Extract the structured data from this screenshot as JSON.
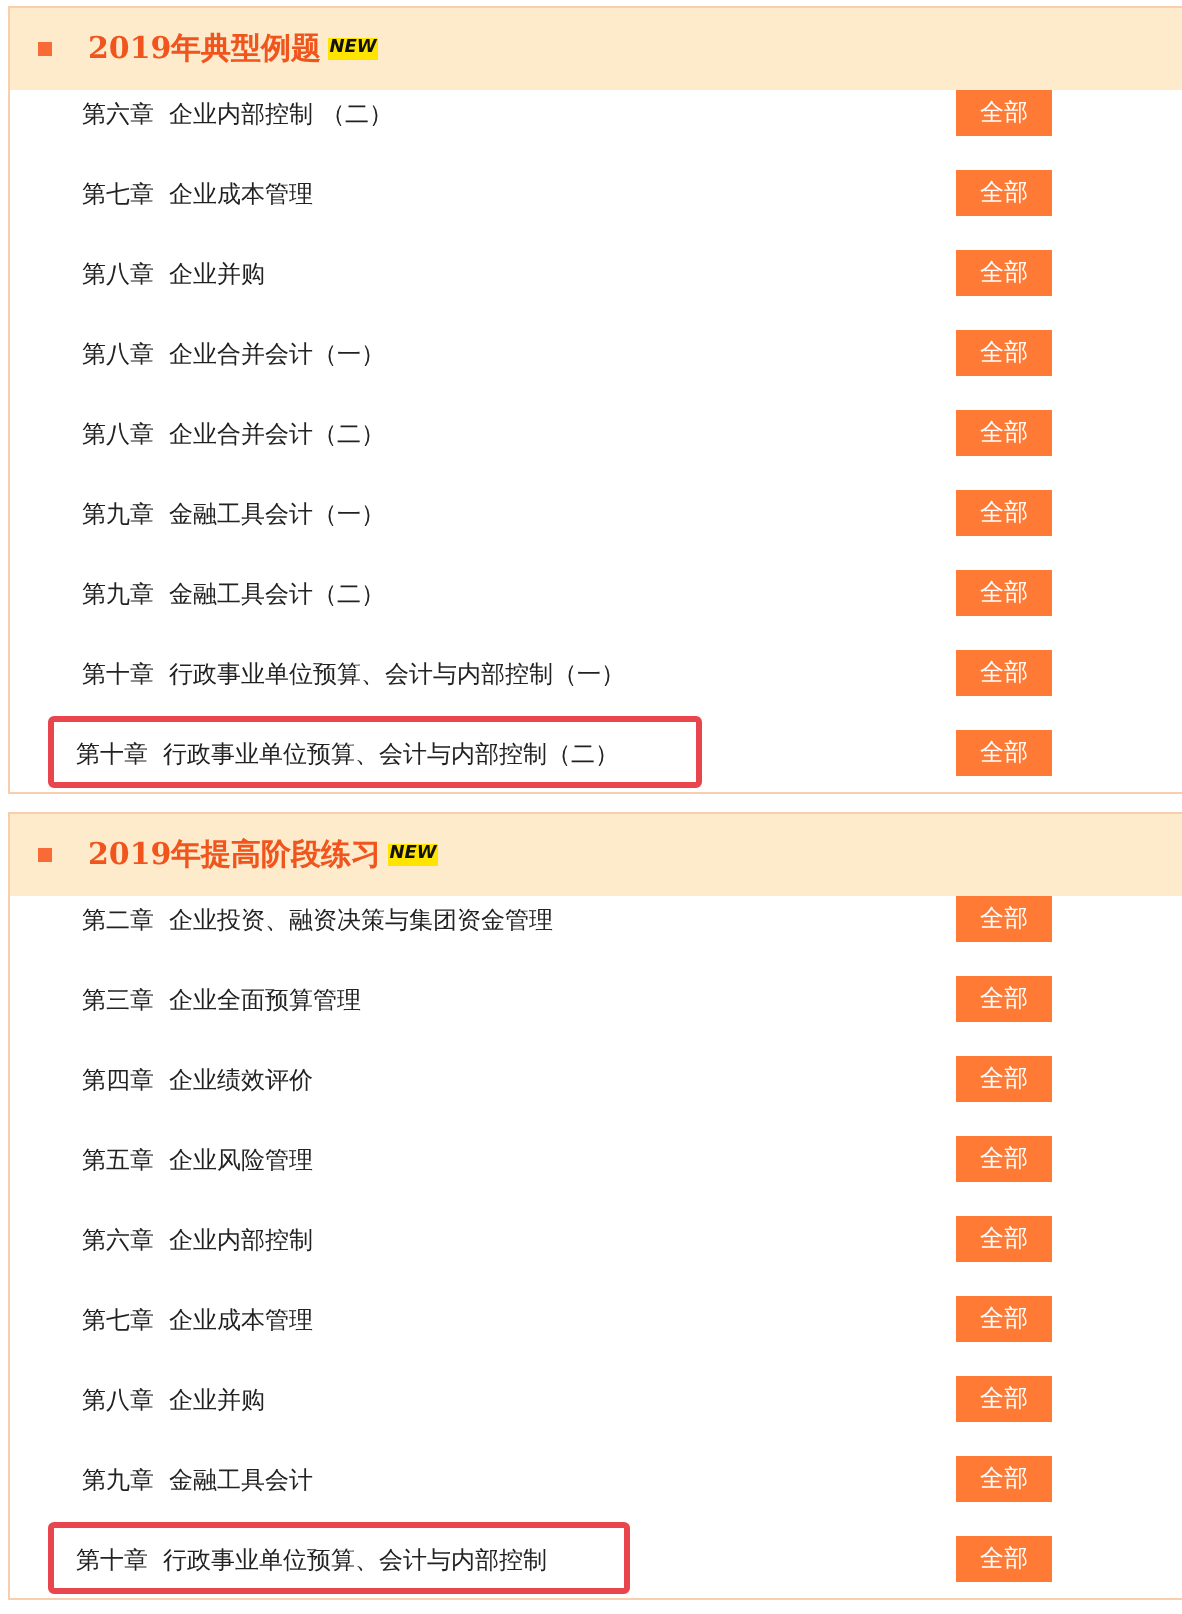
{
  "sections": [
    {
      "title": "2019年典型例题",
      "badge": "NEW",
      "rows": [
        {
          "chapter": "第六章  企业内部控制 （二）",
          "button": "全部",
          "highlighted": false
        },
        {
          "chapter": "第七章  企业成本管理",
          "button": "全部",
          "highlighted": false
        },
        {
          "chapter": "第八章  企业并购",
          "button": "全部",
          "highlighted": false
        },
        {
          "chapter": "第八章  企业合并会计（一）",
          "button": "全部",
          "highlighted": false
        },
        {
          "chapter": "第八章  企业合并会计（二）",
          "button": "全部",
          "highlighted": false
        },
        {
          "chapter": "第九章  金融工具会计（一）",
          "button": "全部",
          "highlighted": false
        },
        {
          "chapter": "第九章  金融工具会计（二）",
          "button": "全部",
          "highlighted": false
        },
        {
          "chapter": "第十章  行政事业单位预算、会计与内部控制（一）",
          "button": "全部",
          "highlighted": false
        },
        {
          "chapter": "第十章  行政事业单位预算、会计与内部控制（二）",
          "button": "全部",
          "highlighted": true
        }
      ]
    },
    {
      "title": "2019年提高阶段练习",
      "badge": "NEW",
      "rows": [
        {
          "chapter": "第二章  企业投资、融资决策与集团资金管理",
          "button": "全部",
          "highlighted": false
        },
        {
          "chapter": "第三章  企业全面预算管理",
          "button": "全部",
          "highlighted": false
        },
        {
          "chapter": "第四章  企业绩效评价",
          "button": "全部",
          "highlighted": false
        },
        {
          "chapter": "第五章  企业风险管理",
          "button": "全部",
          "highlighted": false
        },
        {
          "chapter": "第六章  企业内部控制",
          "button": "全部",
          "highlighted": false
        },
        {
          "chapter": "第七章  企业成本管理",
          "button": "全部",
          "highlighted": false
        },
        {
          "chapter": "第八章  企业并购",
          "button": "全部",
          "highlighted": false
        },
        {
          "chapter": "第九章  金融工具会计",
          "button": "全部",
          "highlighted": false
        },
        {
          "chapter": "第十章  行政事业单位预算、会计与内部控制",
          "button": "全部",
          "highlighted": true
        }
      ]
    }
  ]
}
